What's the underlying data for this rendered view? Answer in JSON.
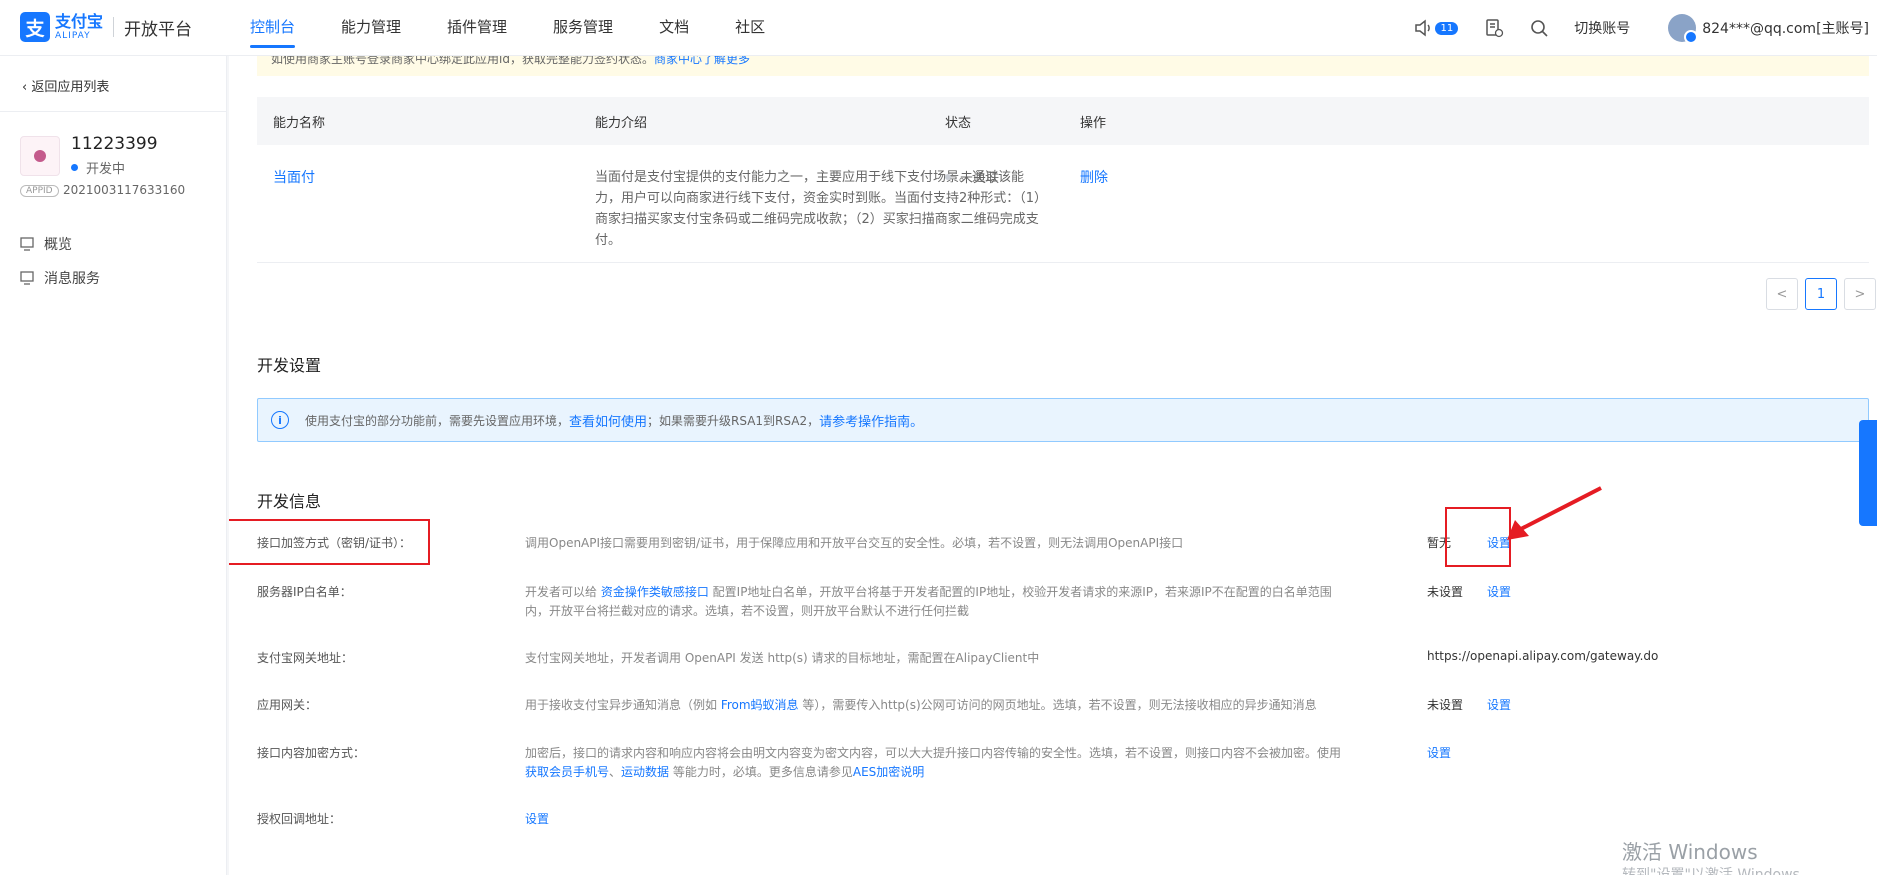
{
  "header": {
    "logo_cn": "支付宝",
    "logo_en": "ALIPAY",
    "platform": "开放平台",
    "nav": [
      "控制台",
      "能力管理",
      "插件管理",
      "服务管理",
      "文档",
      "社区"
    ],
    "notice_count": "11",
    "switch_account": "切换账号",
    "user": "824***@qq.com[主账号]"
  },
  "sidebar": {
    "back": "返回应用列表",
    "app_name": "11223399",
    "app_status": "开发中",
    "appid_tag": "APPID",
    "appid": "2021003117633160",
    "menu": [
      "概览",
      "消息服务"
    ]
  },
  "top_notice": {
    "text": "如使用商家主账号登录商家中心绑定此应用id，获取完整能力签约状态。",
    "link": "商家中心了解更多"
  },
  "table": {
    "headers": [
      "能力名称",
      "能力介绍",
      "状态",
      "操作"
    ],
    "rows": [
      {
        "name": "当面付",
        "desc": "当面付是支付宝提供的支付能力之一，主要应用于线下支付场景。通过该能力，用户可以向商家进行线下支付，资金实时到账。当面付支持2种形式：（1）商家扫描买家支付宝条码或二维码完成收款；（2）买家扫描商家二维码完成支付。",
        "status": "未关联",
        "op": "删除"
      }
    ],
    "pager": {
      "prev": "<",
      "current": "1",
      "next": ">"
    }
  },
  "dev_settings": {
    "title": "开发设置",
    "banner": {
      "text1": "使用支付宝的部分功能前，需要先设置应用环境，",
      "link1": "查看如何使用",
      "text2": "；如果需要升级RSA1到RSA2，",
      "link2": "请参考操作指南。"
    }
  },
  "dev_info": {
    "title": "开发信息",
    "rows": [
      {
        "label": "接口加签方式（密钥/证书）：",
        "desc": [
          "调用OpenAPI接口需要用到密钥/证书，用于保障应用和开放平台交互的安全性。必填，若不设置，则无法调用OpenAPI接口"
        ],
        "value": "暂无",
        "action": "设置"
      },
      {
        "label": "服务器IP白名单：",
        "desc": [
          "开发者可以给 ",
          "资金操作类敏感接口",
          " 配置IP地址白名单，开放平台将基于开发者配置的IP地址，校验开发者请求的来源IP，若来源IP不在配置的白名单范围内，开放平台将拦截对应的请求。选填，若不设置，则开放平台默认不进行任何拦截"
        ],
        "value": "未设置",
        "action": "设置"
      },
      {
        "label": "支付宝网关地址：",
        "desc": [
          "支付宝网关地址，开发者调用 OpenAPI 发送 http(s) 请求的目标地址，需配置在AlipayClient中"
        ],
        "value": "https://openapi.alipay.com/gateway.do",
        "action": ""
      },
      {
        "label": "应用网关：",
        "desc": [
          "用于接收支付宝异步通知消息（例如 ",
          "From蚂蚁消息",
          " 等），需要传入http(s)公网可访问的网页地址。选填，若不设置，则无法接收相应的异步通知消息"
        ],
        "value": "未设置",
        "action": "设置"
      },
      {
        "label": "接口内容加密方式：",
        "desc": [
          "加密后，接口的请求内容和响应内容将会由明文内容变为密文内容，可以大大提升接口内容传输的安全性。选填，若不设置，则接口内容不会被加密。使用 ",
          "获取会员手机号",
          "、",
          "运动数据",
          " 等能力时，必填。更多信息请参见",
          "AES加密说明"
        ],
        "value": "",
        "action": "设置"
      },
      {
        "label": "授权回调地址：",
        "desc": [],
        "value": "",
        "action": "设置"
      }
    ]
  },
  "watermark": {
    "title": "激活 Windows",
    "sub": "转到\"设置\"以激活 Windows。"
  },
  "colors": {
    "primary": "#1677ff",
    "highlight": "#e51c23"
  }
}
